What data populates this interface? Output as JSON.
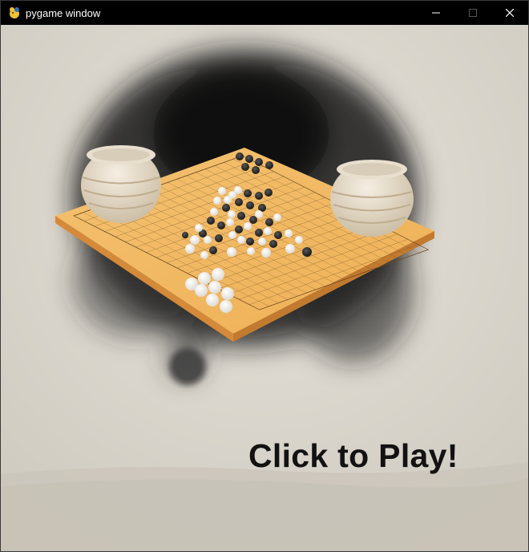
{
  "window": {
    "title": "pygame window",
    "icon": "pygame-snake-icon",
    "controls": [
      "minimize-icon",
      "maximize-icon",
      "close-icon"
    ]
  },
  "scene": {
    "cta_text": "Click to Play!",
    "theme_colors": {
      "paper": "#d8d4cb",
      "board": "#f0b860",
      "ink": "#1a1a1a",
      "stone_white": "#f7f5f0",
      "stone_black": "#252525"
    }
  }
}
